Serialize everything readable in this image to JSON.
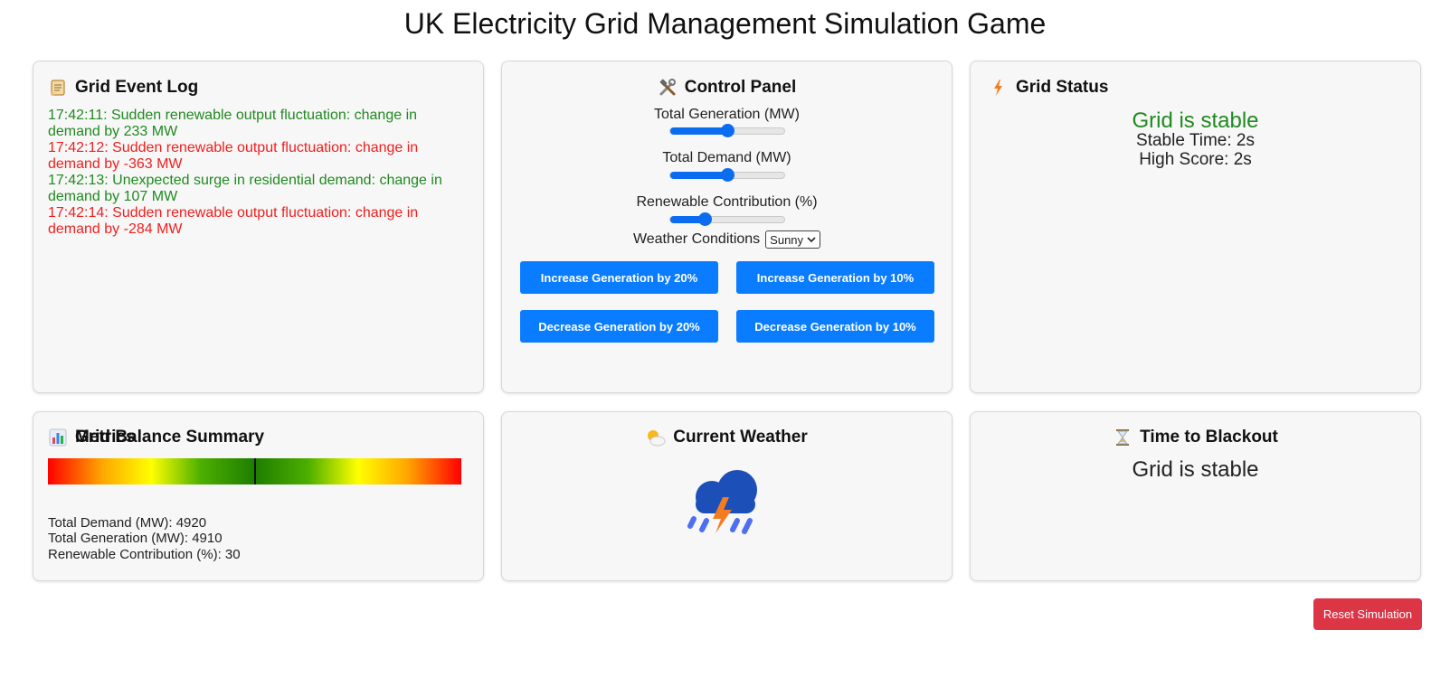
{
  "title": "UK Electricity Grid Management Simulation Game",
  "event_log": {
    "heading": "Grid Event Log",
    "icon": "scroll-icon",
    "entries": [
      {
        "text": "17:42:11: Sudden renewable output fluctuation: change in demand by 233 MW",
        "color": "#1f8a1f"
      },
      {
        "text": "17:42:12: Sudden renewable output fluctuation: change in demand by -363 MW",
        "color": "#f01f1f"
      },
      {
        "text": "17:42:13: Unexpected surge in residential demand: change in demand by 107 MW",
        "color": "#1f8a1f"
      },
      {
        "text": "17:42:14: Sudden renewable output fluctuation: change in demand by -284 MW",
        "color": "#f01f1f"
      }
    ]
  },
  "control_panel": {
    "heading": "Control Panel",
    "icon": "tools-icon",
    "sliders": [
      {
        "label": "Total Generation (MW)",
        "level_fraction": 0.5
      },
      {
        "label": "Total Demand (MW)",
        "level_fraction": 0.5
      },
      {
        "label": "Renewable Contribution (%)",
        "level_fraction": 0.3
      }
    ],
    "weather_label": "Weather Conditions",
    "weather_selected": "Sunny",
    "buttons": {
      "inc20": "Increase Generation by 20%",
      "inc10": "Increase Generation by 10%",
      "dec20": "Decrease Generation by 20%",
      "dec10": "Decrease Generation by 10%"
    },
    "accent_color": "#0a7cff"
  },
  "grid_status": {
    "heading": "Grid Status",
    "icon": "lightning-icon",
    "status": "Grid is stable",
    "stable_time": "Stable Time: 2s",
    "high_score": "High Score: 2s",
    "status_color": "#1f8a1f"
  },
  "balance_summary": {
    "heading": "Grid Balance Summary",
    "icon": "balance-scale-icon",
    "balance_fraction": 0.5,
    "metrics_heading": "Metrics",
    "metrics_icon": "bar-chart-icon",
    "metrics": [
      "Total Demand (MW): 4920",
      "Total Generation (MW): 4910",
      "Renewable Contribution (%): 30"
    ]
  },
  "current_weather": {
    "heading": "Current Weather",
    "icon": "sun-behind-cloud-icon",
    "weather_icon": "thunderstorm-icon"
  },
  "blackout": {
    "heading": "Time to Blackout",
    "icon": "hourglass-icon",
    "text": "Grid is stable"
  },
  "reset_button": {
    "label": "Reset Simulation",
    "color": "#dc3545"
  }
}
